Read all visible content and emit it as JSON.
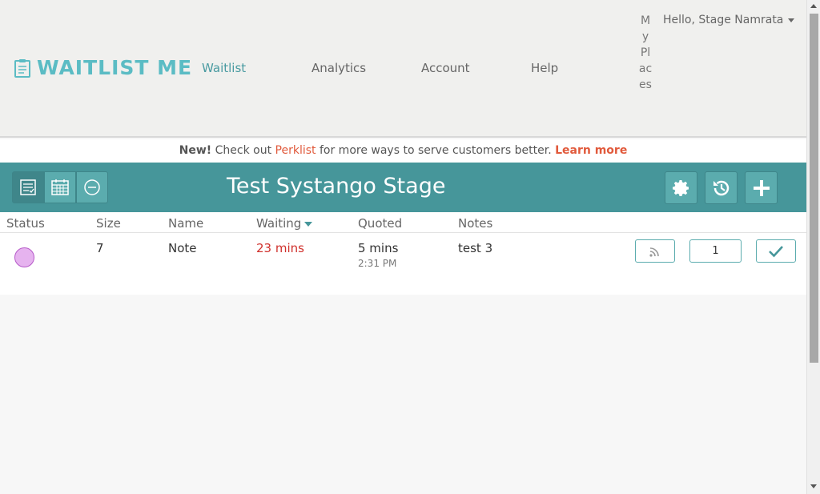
{
  "brand": {
    "name": "WAITLIST ME",
    "icon": "clipboard-icon",
    "color": "#5bbcc4"
  },
  "nav": {
    "items": [
      {
        "label": "Waitlist",
        "active": true
      },
      {
        "label": "Analytics",
        "active": false
      },
      {
        "label": "Account",
        "active": false
      },
      {
        "label": "Help",
        "active": false
      }
    ],
    "my_places": "My Places",
    "greeting": "Hello, Stage Namrata"
  },
  "banner": {
    "new": "New!",
    "text_before": " Check out ",
    "perklist": "Perklist",
    "text_after": " for more ways to serve customers better. ",
    "learn_more": "Learn more"
  },
  "toolbar": {
    "title": "Test Systango Stage",
    "view_buttons": [
      "list-view-icon",
      "calendar-view-icon",
      "remove-icon"
    ],
    "action_buttons": [
      "gear-icon",
      "history-icon",
      "plus-icon"
    ],
    "color": "#46969a"
  },
  "table": {
    "columns": [
      "Status",
      "Size",
      "Name",
      "Waiting",
      "Quoted",
      "Notes"
    ],
    "sort_column": "Waiting",
    "rows": [
      {
        "status_color": "#e6b3ef",
        "size": "7",
        "name": "Note",
        "waiting": "23 mins",
        "quoted": "5 mins",
        "quoted_time": "2:31 PM",
        "notes": "test 3",
        "notify_icon": "rss-icon",
        "table_number": "1",
        "seat_icon": "check-icon"
      }
    ]
  }
}
